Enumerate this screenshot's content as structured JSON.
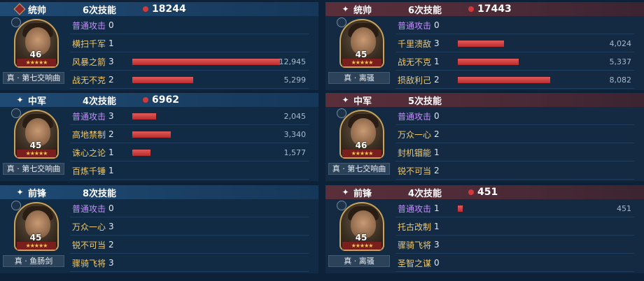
{
  "left": [
    {
      "role": "统帅",
      "skills": "6次技能",
      "damage": "18244",
      "level": "46",
      "stars": "★★★★★",
      "title": "真 · 第七交响曲",
      "rows": [
        {
          "name": "普通攻击",
          "count": "0",
          "value": "",
          "pct": 0,
          "basic": true
        },
        {
          "name": "横扫千军",
          "count": "1",
          "value": "",
          "pct": 0
        },
        {
          "name": "风暴之箭",
          "count": "3",
          "value": "12,945",
          "pct": 0.8
        },
        {
          "name": "战无不克",
          "count": "2",
          "value": "5,299",
          "pct": 0.33
        }
      ]
    },
    {
      "role": "中军",
      "skills": "4次技能",
      "damage": "6962",
      "level": "45",
      "stars": "★★★★★",
      "title": "真 · 第七交响曲",
      "rows": [
        {
          "name": "普通攻击",
          "count": "3",
          "value": "2,045",
          "pct": 0.13,
          "basic": true
        },
        {
          "name": "高地禁制",
          "count": "2",
          "value": "3,340",
          "pct": 0.21
        },
        {
          "name": "诛心之论",
          "count": "1",
          "value": "1,577",
          "pct": 0.1
        },
        {
          "name": "百炼千锤",
          "count": "1",
          "value": "",
          "pct": 0
        }
      ]
    },
    {
      "role": "前锋",
      "skills": "8次技能",
      "damage": "",
      "level": "45",
      "stars": "★★★★★",
      "title": "真 · 鱼肠剑",
      "rows": [
        {
          "name": "普通攻击",
          "count": "0",
          "value": "",
          "pct": 0,
          "basic": true
        },
        {
          "name": "万众一心",
          "count": "3",
          "value": "",
          "pct": 0
        },
        {
          "name": "锐不可当",
          "count": "2",
          "value": "",
          "pct": 0
        },
        {
          "name": "骤骑飞将",
          "count": "3",
          "value": "",
          "pct": 0
        }
      ]
    }
  ],
  "right": [
    {
      "role": "统帅",
      "skills": "6次技能",
      "damage": "17443",
      "level": "45",
      "stars": "★★★★★",
      "title": "真 · 离骚",
      "rows": [
        {
          "name": "普通攻击",
          "count": "0",
          "value": "",
          "pct": 0,
          "basic": true
        },
        {
          "name": "千里溃敌",
          "count": "3",
          "value": "4,024",
          "pct": 0.25
        },
        {
          "name": "战无不克",
          "count": "1",
          "value": "5,337",
          "pct": 0.33
        },
        {
          "name": "损敌利己",
          "count": "2",
          "value": "8,082",
          "pct": 0.5
        }
      ]
    },
    {
      "role": "中军",
      "skills": "5次技能",
      "damage": "",
      "level": "46",
      "stars": "★★★★★",
      "title": "真 · 第七交响曲",
      "rows": [
        {
          "name": "普通攻击",
          "count": "0",
          "value": "",
          "pct": 0,
          "basic": true
        },
        {
          "name": "万众一心",
          "count": "2",
          "value": "",
          "pct": 0
        },
        {
          "name": "封机锢能",
          "count": "1",
          "value": "",
          "pct": 0
        },
        {
          "name": "锐不可当",
          "count": "2",
          "value": "",
          "pct": 0
        }
      ]
    },
    {
      "role": "前锋",
      "skills": "4次技能",
      "damage": "451",
      "level": "45",
      "stars": "★★★★★",
      "title": "真 · 离骚",
      "rows": [
        {
          "name": "普通攻击",
          "count": "1",
          "value": "451",
          "pct": 0.028,
          "basic": true
        },
        {
          "name": "托古改制",
          "count": "1",
          "value": "",
          "pct": 0
        },
        {
          "name": "骤骑飞将",
          "count": "3",
          "value": "",
          "pct": 0
        },
        {
          "name": "圣智之谋",
          "count": "0",
          "value": "",
          "pct": 0
        }
      ]
    }
  ],
  "colors": {
    "bar": "#d23a3a",
    "basic_skill": "#c58cff",
    "skill": "#f2c866"
  },
  "icons": {
    "commander_badge": "diamond-badge-icon",
    "role_mark": "sparkle-icon",
    "damage_marker": "red-dot-icon"
  }
}
